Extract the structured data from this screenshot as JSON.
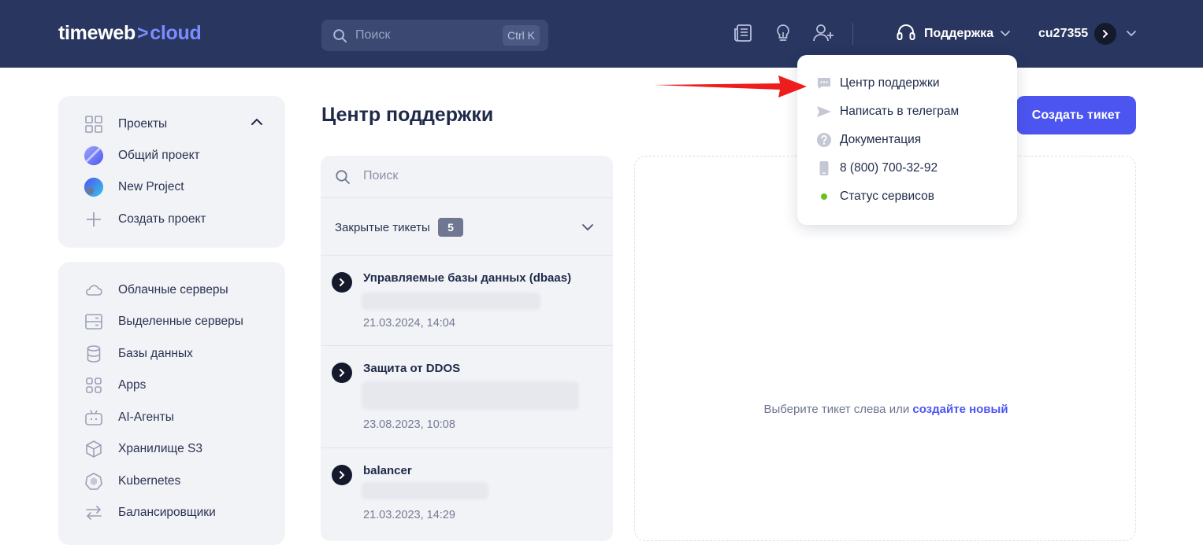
{
  "header": {
    "logo": {
      "part1": "timeweb",
      "part2": "cloud"
    },
    "search": {
      "placeholder": "Поиск",
      "shortcut": "Ctrl K"
    },
    "icons": [
      "news-icon",
      "lightbulb-icon",
      "add-user-icon"
    ],
    "support_label": "Поддержка",
    "username": "cu27355"
  },
  "sidebar": {
    "projects": {
      "title": "Проекты",
      "items": [
        {
          "label": "Общий проект",
          "icon": "project-avatar-icon"
        },
        {
          "label": "New Project",
          "icon": "project-avatar-icon"
        },
        {
          "label": "Создать проект",
          "icon": "plus-icon"
        }
      ]
    },
    "nav": [
      {
        "label": "Облачные серверы",
        "icon": "cloud-icon"
      },
      {
        "label": "Выделенные серверы",
        "icon": "server-icon"
      },
      {
        "label": "Базы данных",
        "icon": "database-icon"
      },
      {
        "label": "Apps",
        "icon": "apps-icon"
      },
      {
        "label": "AI-Агенты",
        "icon": "robot-icon"
      },
      {
        "label": "Хранилище S3",
        "icon": "cube-icon"
      },
      {
        "label": "Kubernetes",
        "icon": "kubernetes-icon"
      },
      {
        "label": "Балансировщики",
        "icon": "balancer-icon"
      }
    ]
  },
  "main": {
    "title": "Центр поддержки",
    "create_button": "Создать тикет",
    "tickets": {
      "search_placeholder": "Поиск",
      "closed_label": "Закрытые тикеты",
      "closed_count": "5",
      "items": [
        {
          "title": "Управляемые базы данных (dbaas)",
          "date": "21.03.2024, 14:04"
        },
        {
          "title": "Защита от DDOS",
          "date": "23.08.2023, 10:08"
        },
        {
          "title": "balancer",
          "date": "21.03.2023, 14:29"
        }
      ]
    },
    "empty_state": {
      "text": "Выберите тикет слева или",
      "link": "создайте новый"
    }
  },
  "support_menu": {
    "items": [
      {
        "label": "Центр поддержки",
        "icon": "chat-icon"
      },
      {
        "label": "Написать в телеграм",
        "icon": "telegram-icon"
      },
      {
        "label": "Документация",
        "icon": "question-icon"
      },
      {
        "label": "8 (800) 700-32-92",
        "icon": "phone-icon"
      },
      {
        "label": "Статус сервисов",
        "icon": "status-dot-icon"
      }
    ]
  },
  "colors": {
    "header_bg": "#283660",
    "accent": "#4c55f0",
    "annotation_arrow": "#ee1c1c",
    "status_ok": "#6cc01a"
  }
}
